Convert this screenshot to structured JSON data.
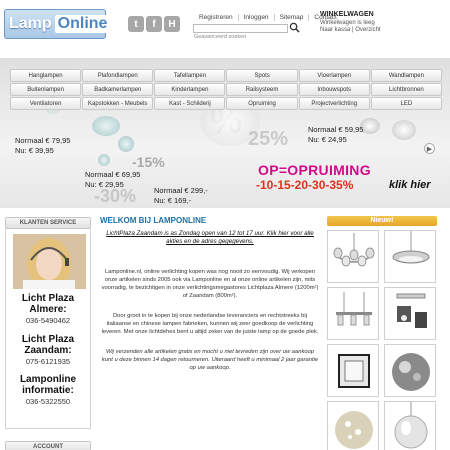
{
  "header": {
    "logo_left": "Lamp",
    "logo_right": "Online",
    "social": [
      {
        "icon": "twitter-icon",
        "glyph": "t"
      },
      {
        "icon": "facebook-icon",
        "glyph": "f"
      },
      {
        "icon": "hyves-icon",
        "glyph": "H"
      }
    ],
    "toplinks": [
      "Registreren",
      "Inloggen",
      "Sitemap",
      "Contact"
    ],
    "search_placeholder": "",
    "advanced_search": "Geavanceerd zoeken",
    "cart": {
      "title": "WINKELWAGEN",
      "status": "Winkelwagen is leeg",
      "links": "Naar kassa | Overzicht"
    }
  },
  "nav": [
    "Hanglampen",
    "Plafondlampen",
    "Tafellampen",
    "Spots",
    "Vloerlampen",
    "Wandlampen",
    "Buitenlampen",
    "Badkamerlampen",
    "Kinderlampen",
    "Railsysteem",
    "Inbouwspots",
    "Lichtbronnen",
    "Ventilatoren",
    "Kapstokken - Meubels",
    "Kast - Schilderij",
    "Opruiming",
    "Projectverlichting",
    "LED"
  ],
  "banner": {
    "prices": [
      {
        "normaal": "Normaal € 79,95",
        "nu": "Nu: € 39,95"
      },
      {
        "normaal": "Normaal € 69,95",
        "nu": "Nu: € 29,95"
      },
      {
        "normaal": "Normaal € 299,-",
        "nu": "Nu: € 169,-"
      },
      {
        "normaal": "Normaal € 59,95",
        "nu": "Nu: € 24,95"
      }
    ],
    "promo_title": "OP=OPRUIMING",
    "promo_pcts": "-10-15-20-30-35%",
    "promo_cta": "klik hier",
    "pct_marks": [
      "-50%",
      "-25%",
      "-15%",
      "-30%",
      "25%"
    ]
  },
  "sidebar": {
    "service_title": "KLANTEN SERVICE",
    "contacts": [
      {
        "label": "Licht Plaza Almere:",
        "number": "036-5490462"
      },
      {
        "label": "Licht Plaza Zaandam:",
        "number": "075-6121935"
      },
      {
        "label": "Lamponline informatie:",
        "number": "036-5322550"
      }
    ],
    "account_title": "ACCOUNT"
  },
  "main": {
    "title": "WELKOM BIJ LAMPONLINE",
    "notice": "LichtPlaza Zaandam is as Zondag open van 12 tot 17 uur. Klik hier voor alle akties en de adres gegegevens.",
    "para1": "Lamponline.nl, online verlichting kopen was nog nooit zo eenvoudig. Wij verkopen onze artikelen sinds 2005 ook via Lamponline en al onze online artikelen zijn, mits voorradig, te bezichtigen in onze verlichtingsmegastores Lichtplaza Almere (1200m²) of Zaandam (800m²).",
    "para2": "Door groot in te kopen bij onze nederlandse leveranciers en rechtstreeks bij italiaanse en chinese lampen fabrieken, kunnen wij zeer goedkoop de verlichting leveren. Met onze lichtdehes bent u altijd zeker van de juiste lamp op de goede plek.",
    "para3": "Wij verzenden alle artikelen gratis en mocht u niet tevreden zijn over uw aankoop kunt u deze binnen 14 dagen retourneren. Uiteraard heeft u minimaal 2 jaar garantie op uw aankoop."
  },
  "new": {
    "title": "Nieuw!",
    "items": [
      "chandelier",
      "pendant-disc",
      "bar-pendant",
      "ceiling-spots",
      "cube-lantern",
      "mirror-ball",
      "crystal-globe",
      "glass-shade"
    ]
  },
  "colors": {
    "brand_blue": "#4f86bf",
    "heading_blue": "#1d6fa5",
    "promo_pink": "#d20a8a",
    "promo_red": "#e0301e",
    "new_orange": "#e6a52a"
  }
}
